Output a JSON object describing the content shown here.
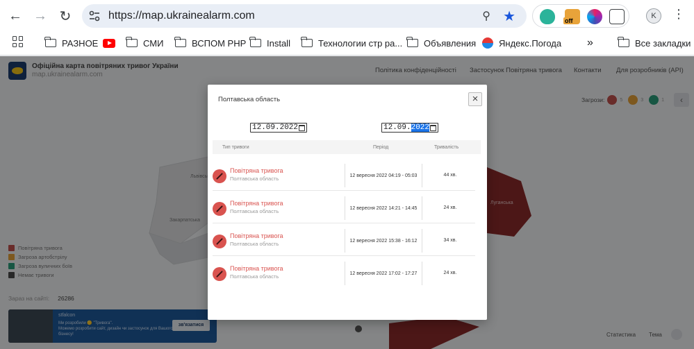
{
  "browser": {
    "url": "https://map.ukrainealarm.com",
    "profile_initial": "K",
    "ext_badge": "off",
    "bookmarks": [
      {
        "label": "РАЗНОЕ",
        "icon": "folder-icon"
      },
      {
        "label": "",
        "icon": "youtube-icon"
      },
      {
        "label": "СМИ",
        "icon": "folder-icon"
      },
      {
        "label": "ВСПОМ PHP",
        "icon": "folder-icon"
      },
      {
        "label": "Install",
        "icon": "folder-icon"
      },
      {
        "label": "Технологии стр ра...",
        "icon": "folder-icon"
      },
      {
        "label": "Объявления",
        "icon": "folder-icon"
      },
      {
        "label": "Яндекс.Погода",
        "icon": "weather-icon"
      }
    ],
    "more": "»",
    "all_bookmarks": "Все закладки"
  },
  "site": {
    "title": "Офіційна карта повітряних тривог України",
    "subtitle": "map.ukrainealarm.com",
    "nav": [
      "Політика конфіденційності",
      "Застосунок Повітряна тривога",
      "Контакти",
      "Для розробників (API)"
    ],
    "threats_label": "Загрози:",
    "threat_counts": [
      "5",
      "3",
      "1"
    ],
    "map_labels": [
      "Львівська",
      "Закарпатська",
      "Луганська"
    ],
    "legend": [
      {
        "label": "Повітряна тривога",
        "color": "#c0504d"
      },
      {
        "label": "Загроза артобстрілу",
        "color": "#e3a13a"
      },
      {
        "label": "Загроза вуличних боїв",
        "color": "#2a9d7a"
      },
      {
        "label": "Немає тривоги",
        "color": "#4a4a4a"
      }
    ],
    "online_label": "Зараз на сайті:",
    "online_count": "26286",
    "banner": {
      "brand": "stfalcon",
      "line1": "Ми розробили 🟡 \"Тривога\".",
      "line2": "Можемо розробити сайт, дизайн чи застосунок для Вашого бізнесу!",
      "cta": "зв'язатися"
    },
    "footer_links": [
      "Статистика",
      "Тема"
    ]
  },
  "modal": {
    "title": "Полтавська область",
    "date_from": {
      "day_month": "12.09.",
      "year": "2022"
    },
    "date_to": {
      "day_month": "12.09.",
      "year": "2022"
    },
    "columns": [
      "Тип тривоги",
      "Період",
      "Тривалість"
    ],
    "rows": [
      {
        "type": "Повітряна тривога",
        "region": "Полтавська область",
        "period": "12 вересня 2022 04:19 - 05:03",
        "duration": "44 хв."
      },
      {
        "type": "Повітряна тривога",
        "region": "Полтавська область",
        "period": "12 вересня 2022 14:21 - 14:45",
        "duration": "24 хв."
      },
      {
        "type": "Повітряна тривога",
        "region": "Полтавська область",
        "period": "12 вересня 2022 15:38 - 16:12",
        "duration": "34 хв."
      },
      {
        "type": "Повітряна тривога",
        "region": "Полтавська область",
        "period": "12 вересня 2022 17:02 - 17:27",
        "duration": "24 хв."
      }
    ]
  }
}
